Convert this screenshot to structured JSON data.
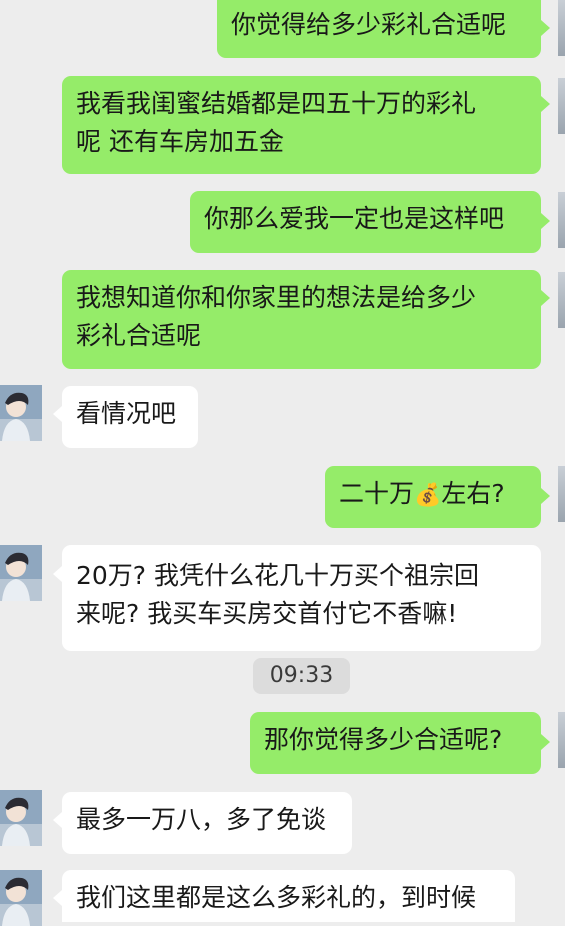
{
  "chat": {
    "messages": [
      {
        "side": "sent",
        "lines": [
          "你觉得给多少彩礼合适呢"
        ]
      },
      {
        "side": "sent",
        "lines": [
          "我看我闺蜜结婚都是四五十万的彩礼",
          "呢  还有车房加五金"
        ]
      },
      {
        "side": "sent",
        "lines": [
          "你那么爱我一定也是这样吧"
        ]
      },
      {
        "side": "sent",
        "lines": [
          "我想知道你和你家里的想法是给多少",
          "彩礼合适呢"
        ]
      },
      {
        "side": "received",
        "lines": [
          "看情况吧"
        ]
      },
      {
        "side": "sent",
        "text_before": "二十万",
        "emoji": "💰",
        "text_after": "左右?"
      },
      {
        "side": "received",
        "lines": [
          "20万? 我凭什么花几十万买个祖宗回",
          "来呢? 我买车买房交首付它不香嘛!"
        ]
      },
      {
        "side": "sent",
        "lines": [
          "那你觉得多少合适呢?"
        ]
      },
      {
        "side": "received",
        "lines": [
          "最多一万八，多了免谈"
        ]
      },
      {
        "side": "received",
        "lines": [
          "我们这里都是这么多彩礼的，到时候"
        ]
      }
    ],
    "timestamp": "09:33"
  },
  "icons": {
    "avatar": "user-avatar-icon",
    "moneybag": "money-bag-emoji"
  },
  "colors": {
    "background": "#ededed",
    "sent_bubble": "#95ec69",
    "received_bubble": "#ffffff"
  }
}
